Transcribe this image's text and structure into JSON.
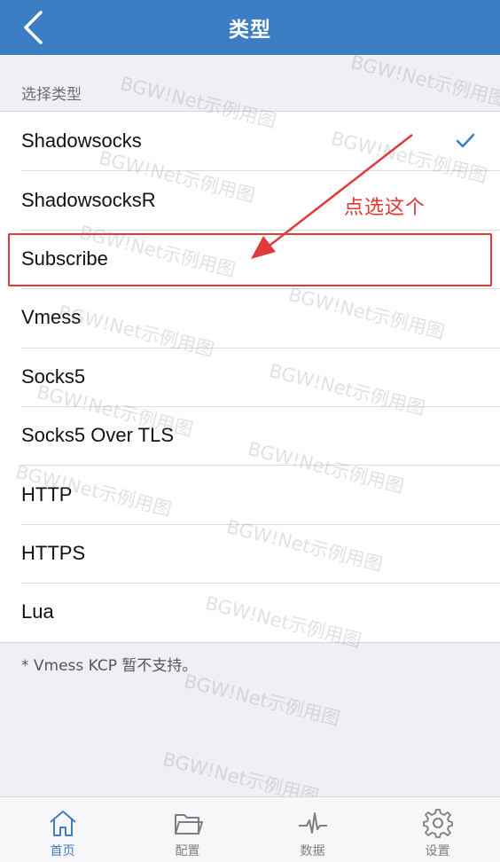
{
  "navbar": {
    "title": "类型"
  },
  "section": {
    "header": "选择类型"
  },
  "types": [
    {
      "label": "Shadowsocks",
      "selected": true
    },
    {
      "label": "ShadowsocksR",
      "selected": false
    },
    {
      "label": "Subscribe",
      "selected": false
    },
    {
      "label": "Vmess",
      "selected": false
    },
    {
      "label": "Socks5",
      "selected": false
    },
    {
      "label": "Socks5 Over TLS",
      "selected": false
    },
    {
      "label": "HTTP",
      "selected": false
    },
    {
      "label": "HTTPS",
      "selected": false
    },
    {
      "label": "Lua",
      "selected": false
    }
  ],
  "footnote": "* Vmess KCP 暂不支持。",
  "annotation": {
    "text": "点选这个",
    "color": "#e8342f"
  },
  "watermark": "BGW!Net示例用图",
  "tabs": [
    {
      "label": "首页",
      "icon": "home-icon",
      "active": true
    },
    {
      "label": "配置",
      "icon": "folder-icon",
      "active": false
    },
    {
      "label": "数据",
      "icon": "pulse-icon",
      "active": false
    },
    {
      "label": "设置",
      "icon": "gear-icon",
      "active": false
    }
  ],
  "colors": {
    "accent": "#3b7ec3",
    "annotation": "#e03a3a"
  }
}
